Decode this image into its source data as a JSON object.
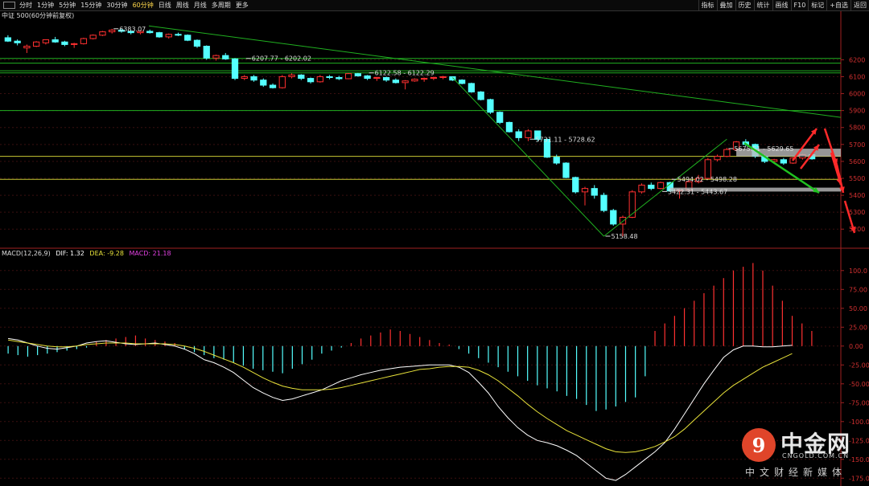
{
  "toolbar": {
    "left_items": [
      "分时",
      "1分钟",
      "5分钟",
      "15分钟",
      "30分钟",
      "60分钟",
      "日线",
      "周线",
      "月线",
      "多周期",
      "更多"
    ],
    "active": "60分钟",
    "right_items": [
      "指标",
      "叠加",
      "历史",
      "统计",
      "画线",
      "F10",
      "标记",
      "+自选",
      "返回"
    ]
  },
  "symbol_label": "中证 500(60分钟前复权)",
  "macd_label": {
    "name": "MACD(12,26,9)",
    "dif": "DIF: 1.32",
    "dea": "DEA: -9.28",
    "macd": "MACD: 21.18"
  },
  "price_axis": {
    "ticks": [
      6200,
      6100,
      6000,
      5900,
      5800,
      5700,
      5600,
      5500,
      5400,
      5300,
      5200
    ]
  },
  "macd_axis": {
    "ticks": [
      "100.0",
      "75.00",
      "50.00",
      "25.00",
      "0.00",
      "-25.00",
      "-50.00",
      "-75.00",
      "-100.0",
      "-125.0",
      "-150.0",
      "-175.0"
    ]
  },
  "annotations": [
    "6383.07",
    "6207.77 - 6202.02",
    "6122.58 - 6122.29",
    "5731.11 - 5728.62",
    "5675.51 - 5629.65",
    "5494.02 - 5498.28",
    "5422.31 - 5443.67",
    "5158.48"
  ],
  "watermark": {
    "logo_glyph": "9",
    "name": "中金网",
    "url": "CNGOLD.COM.CN",
    "slogan": "中文财经新媒体"
  },
  "colors": {
    "up": "#ff3030",
    "down": "#54ffff",
    "dif": "#ffffff",
    "dea": "#e8e23a",
    "hline": "#20b020",
    "yline": "#c8c832",
    "arrow_red": "#ff2a2a",
    "arrow_green": "#20c020"
  },
  "chart_data": [
    {
      "type": "candlestick",
      "title": "中证 500(60分钟前复权)",
      "ylim": [
        5130,
        6420
      ],
      "candles": [
        {
          "o": 6330,
          "h": 6345,
          "l": 6305,
          "c": 6310
        },
        {
          "o": 6310,
          "h": 6320,
          "l": 6285,
          "c": 6300
        },
        {
          "o": 6270,
          "h": 6290,
          "l": 6240,
          "c": 6280
        },
        {
          "o": 6280,
          "h": 6310,
          "l": 6275,
          "c": 6305
        },
        {
          "o": 6300,
          "h": 6320,
          "l": 6290,
          "c": 6318
        },
        {
          "o": 6318,
          "h": 6335,
          "l": 6300,
          "c": 6305
        },
        {
          "o": 6305,
          "h": 6312,
          "l": 6280,
          "c": 6290
        },
        {
          "o": 6290,
          "h": 6300,
          "l": 6270,
          "c": 6295
        },
        {
          "o": 6295,
          "h": 6330,
          "l": 6290,
          "c": 6325
        },
        {
          "o": 6325,
          "h": 6350,
          "l": 6320,
          "c": 6345
        },
        {
          "o": 6345,
          "h": 6370,
          "l": 6340,
          "c": 6365
        },
        {
          "o": 6365,
          "h": 6383,
          "l": 6355,
          "c": 6375
        },
        {
          "o": 6375,
          "h": 6383,
          "l": 6360,
          "c": 6368
        },
        {
          "o": 6368,
          "h": 6375,
          "l": 6350,
          "c": 6360
        },
        {
          "o": 6360,
          "h": 6372,
          "l": 6350,
          "c": 6368
        },
        {
          "o": 6368,
          "h": 6378,
          "l": 6355,
          "c": 6360
        },
        {
          "o": 6360,
          "h": 6365,
          "l": 6330,
          "c": 6335
        },
        {
          "o": 6335,
          "h": 6355,
          "l": 6325,
          "c": 6350
        },
        {
          "o": 6350,
          "h": 6360,
          "l": 6340,
          "c": 6345
        },
        {
          "o": 6345,
          "h": 6350,
          "l": 6310,
          "c": 6315
        },
        {
          "o": 6315,
          "h": 6320,
          "l": 6270,
          "c": 6280
        },
        {
          "o": 6280,
          "h": 6285,
          "l": 6200,
          "c": 6210
        },
        {
          "o": 6210,
          "h": 6230,
          "l": 6195,
          "c": 6225
        },
        {
          "o": 6225,
          "h": 6240,
          "l": 6200,
          "c": 6205
        },
        {
          "o": 6205,
          "h": 6210,
          "l": 6080,
          "c": 6090
        },
        {
          "o": 6090,
          "h": 6110,
          "l": 6080,
          "c": 6100
        },
        {
          "o": 6100,
          "h": 6110,
          "l": 6070,
          "c": 6080
        },
        {
          "o": 6080,
          "h": 6090,
          "l": 6040,
          "c": 6050
        },
        {
          "o": 6050,
          "h": 6060,
          "l": 6030,
          "c": 6035
        },
        {
          "o": 6035,
          "h": 6110,
          "l": 6030,
          "c": 6100
        },
        {
          "o": 6100,
          "h": 6120,
          "l": 6090,
          "c": 6110
        },
        {
          "o": 6110,
          "h": 6115,
          "l": 6080,
          "c": 6090
        },
        {
          "o": 6090,
          "h": 6095,
          "l": 6060,
          "c": 6070
        },
        {
          "o": 6070,
          "h": 6110,
          "l": 6065,
          "c": 6100
        },
        {
          "o": 6100,
          "h": 6110,
          "l": 6085,
          "c": 6095
        },
        {
          "o": 6095,
          "h": 6105,
          "l": 6080,
          "c": 6088
        },
        {
          "o": 6088,
          "h": 6122,
          "l": 6085,
          "c": 6118
        },
        {
          "o": 6118,
          "h": 6122,
          "l": 6100,
          "c": 6105
        },
        {
          "o": 6105,
          "h": 6110,
          "l": 6080,
          "c": 6090
        },
        {
          "o": 6090,
          "h": 6100,
          "l": 6075,
          "c": 6095
        },
        {
          "o": 6095,
          "h": 6100,
          "l": 6070,
          "c": 6080
        },
        {
          "o": 6080,
          "h": 6090,
          "l": 6060,
          "c": 6065
        },
        {
          "o": 6065,
          "h": 6080,
          "l": 6025,
          "c": 6075
        },
        {
          "o": 6075,
          "h": 6090,
          "l": 6070,
          "c": 6085
        },
        {
          "o": 6085,
          "h": 6095,
          "l": 6070,
          "c": 6090
        },
        {
          "o": 6090,
          "h": 6100,
          "l": 6080,
          "c": 6095
        },
        {
          "o": 6095,
          "h": 6105,
          "l": 6085,
          "c": 6100
        },
        {
          "o": 6100,
          "h": 6102,
          "l": 6075,
          "c": 6080
        },
        {
          "o": 6080,
          "h": 6085,
          "l": 6055,
          "c": 6060
        },
        {
          "o": 6060,
          "h": 6065,
          "l": 6005,
          "c": 6010
        },
        {
          "o": 6010,
          "h": 6015,
          "l": 5960,
          "c": 5965
        },
        {
          "o": 5965,
          "h": 5970,
          "l": 5880,
          "c": 5890
        },
        {
          "o": 5890,
          "h": 5895,
          "l": 5820,
          "c": 5830
        },
        {
          "o": 5830,
          "h": 5835,
          "l": 5770,
          "c": 5775
        },
        {
          "o": 5775,
          "h": 5790,
          "l": 5720,
          "c": 5740
        },
        {
          "o": 5740,
          "h": 5790,
          "l": 5720,
          "c": 5780
        },
        {
          "o": 5780,
          "h": 5782,
          "l": 5720,
          "c": 5730
        },
        {
          "o": 5730,
          "h": 5735,
          "l": 5620,
          "c": 5625
        },
        {
          "o": 5625,
          "h": 5640,
          "l": 5580,
          "c": 5590
        },
        {
          "o": 5590,
          "h": 5595,
          "l": 5500,
          "c": 5505
        },
        {
          "o": 5505,
          "h": 5510,
          "l": 5410,
          "c": 5420
        },
        {
          "o": 5420,
          "h": 5450,
          "l": 5340,
          "c": 5440
        },
        {
          "o": 5440,
          "h": 5460,
          "l": 5380,
          "c": 5400
        },
        {
          "o": 5400,
          "h": 5415,
          "l": 5300,
          "c": 5310
        },
        {
          "o": 5310,
          "h": 5320,
          "l": 5220,
          "c": 5230
        },
        {
          "o": 5230,
          "h": 5280,
          "l": 5158,
          "c": 5270
        },
        {
          "o": 5270,
          "h": 5430,
          "l": 5265,
          "c": 5420
        },
        {
          "o": 5420,
          "h": 5470,
          "l": 5410,
          "c": 5460
        },
        {
          "o": 5460,
          "h": 5475,
          "l": 5430,
          "c": 5440
        },
        {
          "o": 5440,
          "h": 5480,
          "l": 5435,
          "c": 5475
        },
        {
          "o": 5475,
          "h": 5480,
          "l": 5420,
          "c": 5425
        },
        {
          "o": 5425,
          "h": 5440,
          "l": 5380,
          "c": 5430
        },
        {
          "o": 5430,
          "h": 5490,
          "l": 5425,
          "c": 5480
        },
        {
          "o": 5480,
          "h": 5520,
          "l": 5470,
          "c": 5500
        },
        {
          "o": 5500,
          "h": 5620,
          "l": 5495,
          "c": 5610
        },
        {
          "o": 5610,
          "h": 5640,
          "l": 5600,
          "c": 5630
        },
        {
          "o": 5630,
          "h": 5680,
          "l": 5625,
          "c": 5670
        },
        {
          "o": 5670,
          "h": 5720,
          "l": 5660,
          "c": 5715
        },
        {
          "o": 5715,
          "h": 5731,
          "l": 5690,
          "c": 5700
        },
        {
          "o": 5700,
          "h": 5705,
          "l": 5620,
          "c": 5630
        },
        {
          "o": 5630,
          "h": 5640,
          "l": 5590,
          "c": 5600
        },
        {
          "o": 5600,
          "h": 5615,
          "l": 5595,
          "c": 5610
        },
        {
          "o": 5610,
          "h": 5620,
          "l": 5580,
          "c": 5590
        },
        {
          "o": 5590,
          "h": 5625,
          "l": 5585,
          "c": 5620
        },
        {
          "o": 5620,
          "h": 5645,
          "l": 5610,
          "c": 5640
        },
        {
          "o": 5640,
          "h": 5650,
          "l": 5610,
          "c": 5615
        }
      ],
      "hlines": [
        6207.77,
        6122.58,
        5900,
        5629.65,
        5494.02
      ],
      "yellow_lines": [
        5629.65,
        5494.02
      ]
    },
    {
      "type": "macd",
      "title": "MACD(12,26,9)",
      "ylim": [
        -180,
        120
      ],
      "dif": [
        10,
        8,
        4,
        0,
        -3,
        -4,
        -2,
        0,
        4,
        6,
        7,
        5,
        3,
        2,
        3,
        4,
        2,
        0,
        -4,
        -10,
        -18,
        -22,
        -28,
        -35,
        -45,
        -55,
        -62,
        -68,
        -72,
        -70,
        -66,
        -62,
        -58,
        -52,
        -46,
        -42,
        -38,
        -35,
        -32,
        -30,
        -28,
        -27,
        -26,
        -25,
        -25,
        -25,
        -28,
        -35,
        -48,
        -62,
        -80,
        -95,
        -108,
        -118,
        -125,
        -128,
        -132,
        -138,
        -145,
        -155,
        -165,
        -175,
        -178,
        -170,
        -160,
        -150,
        -140,
        -128,
        -110,
        -90,
        -70,
        -50,
        -32,
        -15,
        -5,
        0,
        0,
        -1,
        -1,
        0,
        1
      ],
      "dea": [
        8,
        6,
        4,
        2,
        0,
        -1,
        -1,
        0,
        2,
        3,
        4,
        4,
        4,
        3,
        3,
        3,
        3,
        2,
        0,
        -3,
        -7,
        -12,
        -17,
        -22,
        -28,
        -35,
        -42,
        -48,
        -53,
        -56,
        -58,
        -58,
        -58,
        -57,
        -55,
        -52,
        -49,
        -46,
        -43,
        -40,
        -37,
        -34,
        -31,
        -30,
        -28,
        -27,
        -27,
        -28,
        -32,
        -38,
        -46,
        -56,
        -66,
        -77,
        -87,
        -96,
        -104,
        -112,
        -118,
        -124,
        -130,
        -136,
        -140,
        -141,
        -140,
        -137,
        -133,
        -127,
        -120,
        -110,
        -98,
        -86,
        -74,
        -62,
        -52,
        -44,
        -36,
        -28,
        -22,
        -16,
        -10
      ],
      "hist": [
        -10,
        -12,
        -14,
        -12,
        -10,
        -8,
        -6,
        -4,
        -2,
        6,
        8,
        10,
        12,
        14,
        10,
        8,
        6,
        4,
        -4,
        -8,
        -12,
        -16,
        -18,
        -22,
        -26,
        -30,
        -32,
        -34,
        -36,
        -30,
        -24,
        -18,
        -10,
        -6,
        -2,
        4,
        10,
        14,
        18,
        22,
        20,
        16,
        12,
        8,
        4,
        2,
        -4,
        -10,
        -16,
        -22,
        -28,
        -34,
        -40,
        -46,
        -52,
        -56,
        -60,
        -66,
        -70,
        -78,
        -86,
        -84,
        -80,
        -74,
        -68,
        -40,
        20,
        30,
        40,
        50,
        60,
        70,
        80,
        90,
        100,
        105,
        110,
        100,
        80,
        60,
        40,
        30,
        20
      ]
    }
  ]
}
